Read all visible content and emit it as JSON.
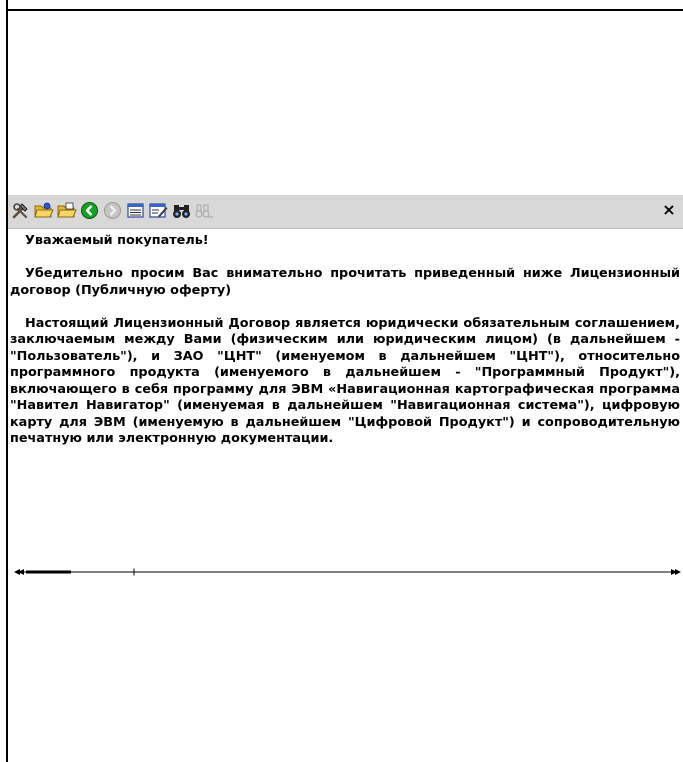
{
  "toolbar": {
    "buttons": [
      {
        "name": "tools-button",
        "icon": "tools-icon",
        "enabled": true
      },
      {
        "name": "open-folder-button",
        "icon": "folder-open-icon",
        "enabled": true
      },
      {
        "name": "open-file-button",
        "icon": "folder-file-icon",
        "enabled": true
      },
      {
        "name": "back-button",
        "icon": "back-arrow-icon",
        "enabled": true
      },
      {
        "name": "forward-button",
        "icon": "forward-arrow-icon",
        "enabled": false
      },
      {
        "name": "list-view-button",
        "icon": "list-icon",
        "enabled": true
      },
      {
        "name": "edit-button",
        "icon": "edit-icon",
        "enabled": true
      },
      {
        "name": "find-button",
        "icon": "binoculars-icon",
        "enabled": true
      },
      {
        "name": "find-next-button",
        "icon": "find-next-icon",
        "enabled": false
      }
    ],
    "close_label": "×"
  },
  "document": {
    "greeting": "Уважаемый покупатель!",
    "paragraph1": "Убедительно просим Вас внимательно прочитать приведенный ниже Лицензионный договор (Публичную оферту)",
    "paragraph2": "Настоящий Лицензионный Договор является юридически обязательным соглашением, заключаемым между Вами (физическим или юридическим лицом) (в дальнейшем - \"Пользователь\"), и ЗАО \"ЦНТ\" (именуемом в дальнейшем \"ЦНТ\"), относительно программного продукта (именуемого в дальнейшем - \"Программный Продукт\"), включающего в себя программу для ЭВМ «Навигационная картографическая программа \"Навител Навигатор\" (именуемая в дальнейшем \"Навигационная система\"), цифровую карту для ЭВМ (именуемую в дальнейшем \"Цифровой Продукт\") и сопроводительную печатную или электронную документации."
  },
  "colors": {
    "toolbar_bg": "#d8d8d8",
    "text": "#000000",
    "background": "#ffffff"
  }
}
